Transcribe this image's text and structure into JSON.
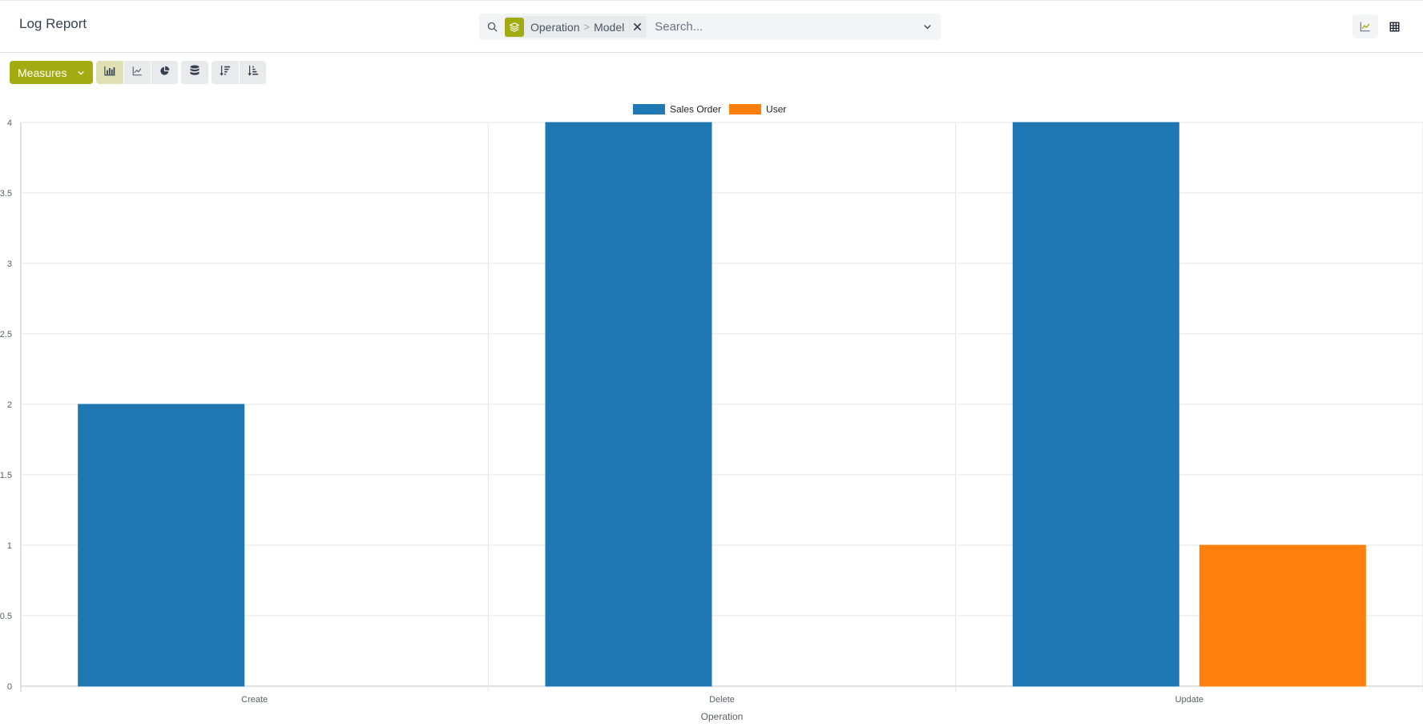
{
  "header": {
    "title": "Log Report"
  },
  "search": {
    "facet_field": "Operation",
    "facet_separator": ">",
    "facet_value": "Model",
    "placeholder": "Search...",
    "value": ""
  },
  "icons": {
    "search": "search-icon",
    "facet": "layers-icon",
    "facet_remove": "close-icon",
    "search_toggle": "chevron-down-icon",
    "view_graph": "line-chart-icon",
    "view_list": "table-icon",
    "measures_caret": "chevron-down-icon",
    "bar_chart": "bar-chart-icon",
    "line_chart": "line-chart-icon",
    "pie_chart": "pie-chart-icon",
    "stacked": "database-icon",
    "sort_desc": "sort-descending-icon",
    "sort_asc": "sort-ascending-icon"
  },
  "toolbar": {
    "measures_label": "Measures",
    "active_chart": "bar"
  },
  "colors": {
    "accent": "#a2ac12",
    "series_sales_order": "#1f77b4",
    "series_user": "#ff7f0e"
  },
  "chart_data": {
    "type": "bar",
    "categories": [
      "Create",
      "Delete",
      "Update"
    ],
    "series": [
      {
        "name": "Sales Order",
        "values": [
          2,
          4,
          4
        ],
        "color": "#1f77b4"
      },
      {
        "name": "User",
        "values": [
          0,
          0,
          1
        ],
        "color": "#ff7f0e"
      }
    ],
    "xlabel": "Operation",
    "ylabel": "",
    "ylim": [
      0,
      4
    ],
    "yticks": [
      "0",
      "0.5",
      "1",
      "1.5",
      "2",
      "2.5",
      "3",
      "3.5",
      "4"
    ],
    "grid": true,
    "legend_position": "top-center"
  }
}
